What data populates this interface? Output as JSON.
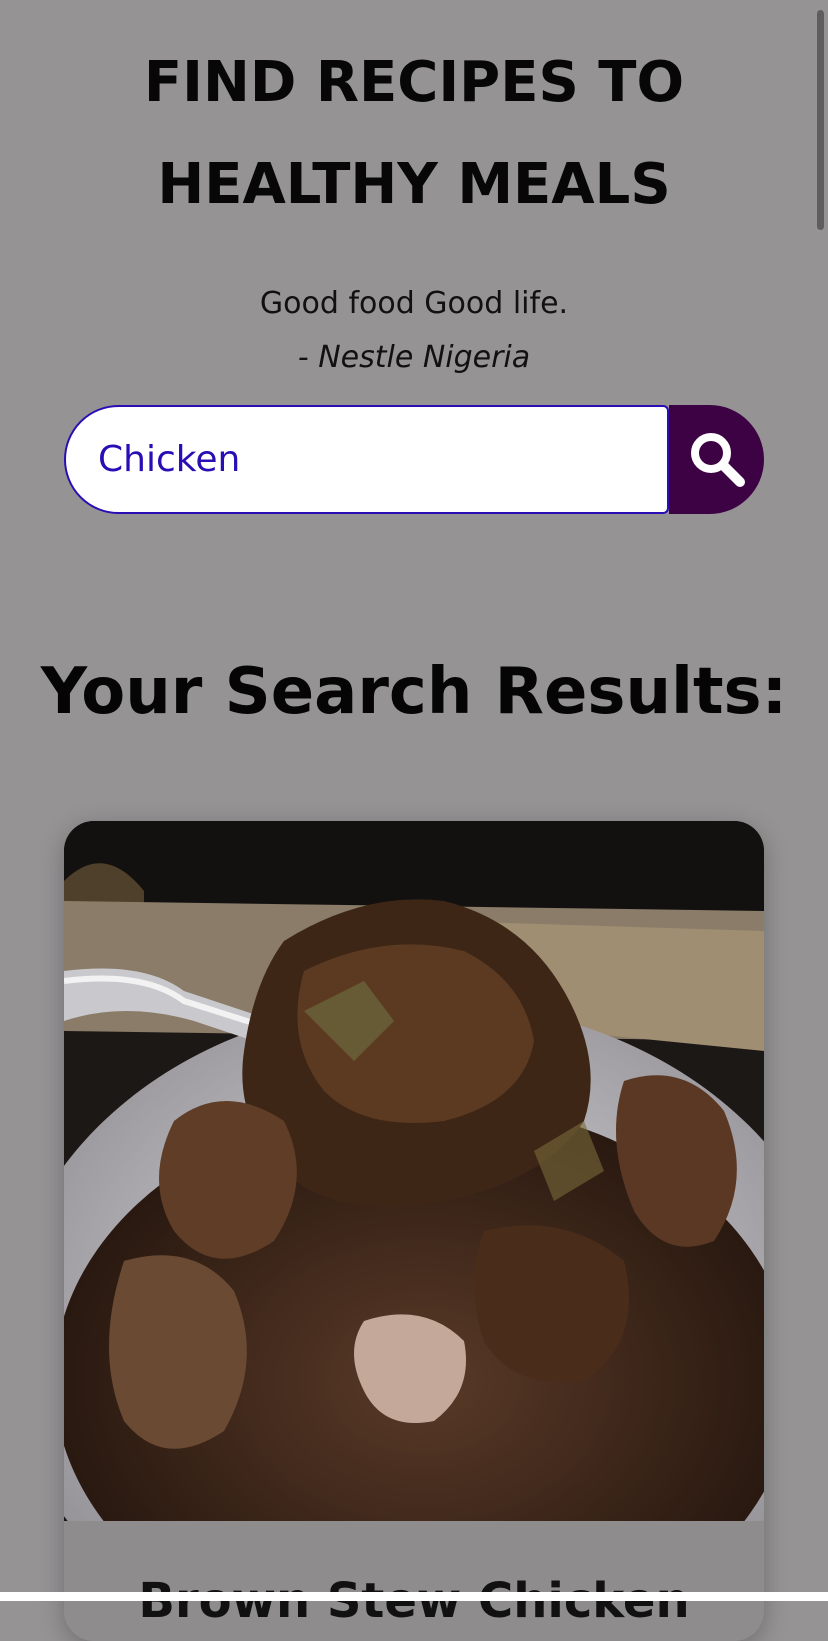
{
  "hero": {
    "title_line1": "FIND RECIPES TO",
    "title_line2": "HEALTHY MEALS",
    "tagline": "Good food Good life.",
    "attribution": "- Nestle Nigeria"
  },
  "search": {
    "value": "Chicken",
    "button_icon": "search-icon",
    "button_color": "#3d0244",
    "accent_color": "#2a0db4"
  },
  "results": {
    "heading": "Your Search Results:",
    "items": [
      {
        "title": "Brown Stew Chicken"
      }
    ]
  }
}
